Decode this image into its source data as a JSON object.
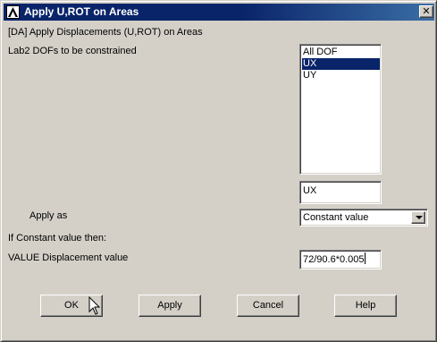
{
  "window": {
    "title": "Apply U,ROT on Areas",
    "close_glyph": "✕",
    "app_icon": "ansys-logo-icon"
  },
  "header": {
    "text": "[DA]  Apply Displacements (U,ROT) on Areas"
  },
  "dofs": {
    "label": "Lab2   DOFs to be constrained",
    "options": [
      "All DOF",
      "UX",
      "UY"
    ],
    "selected": "UX",
    "selected_display": "UX"
  },
  "apply_as": {
    "label": "Apply as",
    "value": "Constant value"
  },
  "constant_section": {
    "label": "If Constant value then:"
  },
  "displacement": {
    "label": "VALUE  Displacement value",
    "value": "72/90.6*0.005"
  },
  "buttons": {
    "ok": "OK",
    "apply": "Apply",
    "cancel": "Cancel",
    "help": "Help"
  },
  "colors": {
    "titlebar": "#0a246a",
    "selection": "#0a246a",
    "dialog_bg": "#d4d0c8"
  }
}
